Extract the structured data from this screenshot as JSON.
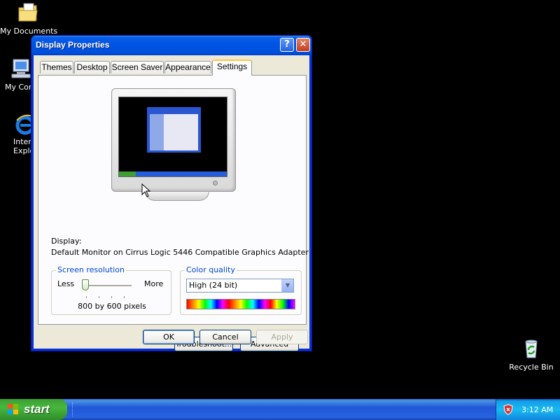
{
  "desktop": {
    "icons": [
      {
        "label": "My Documents",
        "icon": "folder-documents-icon"
      },
      {
        "label": "My Com",
        "icon": "computer-icon"
      },
      {
        "label": "Inter",
        "label2": "Explo",
        "icon": "internet-explorer-icon"
      },
      {
        "label": "Recycle Bin",
        "icon": "recycle-bin-icon"
      }
    ]
  },
  "window": {
    "title": "Display Properties",
    "help_glyph": "?",
    "close_glyph": "✕",
    "tabs": [
      "Themes",
      "Desktop",
      "Screen Saver",
      "Appearance",
      "Settings"
    ],
    "active_tab": "Settings",
    "display_label": "Display:",
    "display_value": "Default Monitor on Cirrus Logic 5446 Compatible Graphics Adapter",
    "screen_resolution": {
      "title": "Screen resolution",
      "less": "Less",
      "more": "More",
      "value": "800 by 600 pixels",
      "slider_position": 0
    },
    "color_quality": {
      "title": "Color quality",
      "selected": "High (24 bit)"
    },
    "buttons": {
      "troubleshoot": "Troubleshoot...",
      "advanced": "Advanced",
      "ok": "OK",
      "cancel": "Cancel",
      "apply": "Apply"
    }
  },
  "taskbar": {
    "start_label": "start",
    "clock": "3:12 AM"
  },
  "colors": {
    "titlebar": "#0054e3",
    "taskbar": "#245edb",
    "start": "#3c9e33",
    "active_tab_highlight": "#ffc83c",
    "group_title": "#0046d5"
  }
}
